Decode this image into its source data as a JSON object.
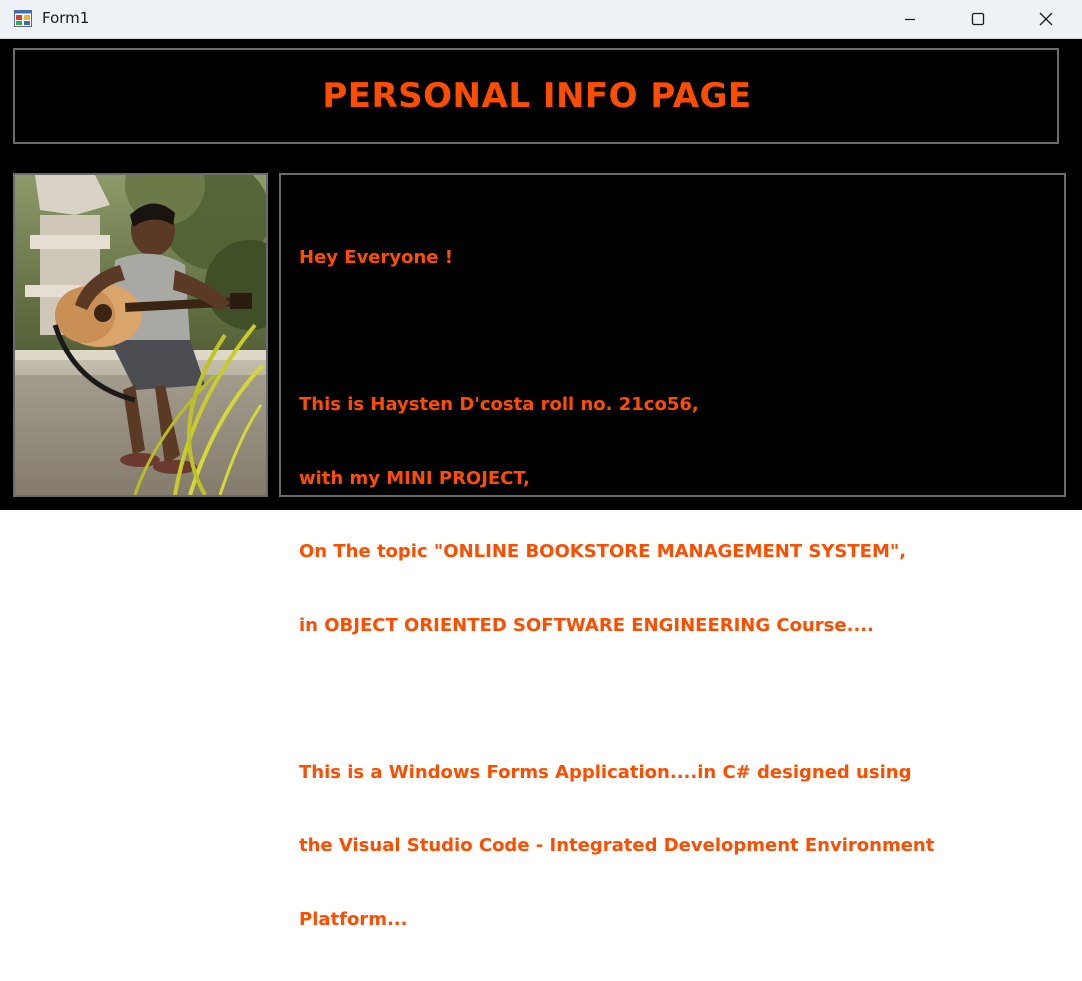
{
  "window": {
    "title": "Form1",
    "controls": {
      "minimize": "minimize-icon",
      "maximize": "maximize-icon",
      "close": "close-icon"
    }
  },
  "header": {
    "title": "PERSONAL INFO PAGE"
  },
  "info": {
    "lines": [
      "Hey Everyone !",
      "",
      "This is Haysten D'costa roll no. 21co56,",
      "with my MINI PROJECT,",
      "On The topic \"ONLINE BOOKSTORE MANAGEMENT SYSTEM\",",
      "in OBJECT ORIENTED SOFTWARE ENGINEERING Course....",
      "",
      "This is a Windows Forms Application....in C# designed using",
      "the Visual Studio Code - Integrated Development Environment",
      "Platform..."
    ]
  },
  "colors": {
    "accent": "#ff4d00",
    "background": "#000000",
    "border": "#6b6b6b",
    "titlebar": "#eef1f6"
  }
}
